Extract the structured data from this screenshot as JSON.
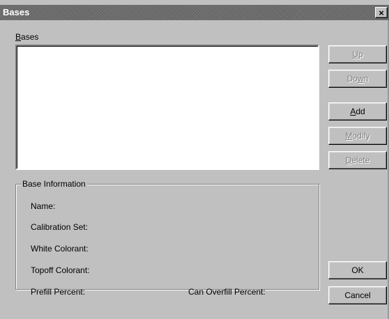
{
  "window": {
    "title": "Bases",
    "close_glyph": "×"
  },
  "list": {
    "label_mnemonic": "B",
    "label_rest": "ases",
    "items": []
  },
  "base_info": {
    "legend": "Base Information",
    "name_label": "Name:",
    "calibration_label": "Calibration Set:",
    "white_label": "White Colorant:",
    "topoff_label": "Topoff Colorant:",
    "prefill_label": "Prefill Percent:",
    "overfill_label": "Can Overfill Percent:"
  },
  "buttons": {
    "up": {
      "pre": "",
      "mn": "U",
      "post": "p",
      "enabled": false
    },
    "down": {
      "pre": "Do",
      "mn": "w",
      "post": "n",
      "enabled": false
    },
    "add": {
      "pre": "",
      "mn": "A",
      "post": "dd",
      "enabled": true
    },
    "modify": {
      "pre": "",
      "mn": "M",
      "post": "odify",
      "enabled": false
    },
    "delete": {
      "pre": "",
      "mn": "D",
      "post": "elete",
      "enabled": false
    },
    "ok": {
      "label": "OK",
      "enabled": true
    },
    "cancel": {
      "label": "Cancel",
      "enabled": true
    }
  },
  "colors": {
    "dialog_bg": "#c0c0c0",
    "titlebar": "#6b6b6b",
    "disabled_text": "#808080"
  }
}
